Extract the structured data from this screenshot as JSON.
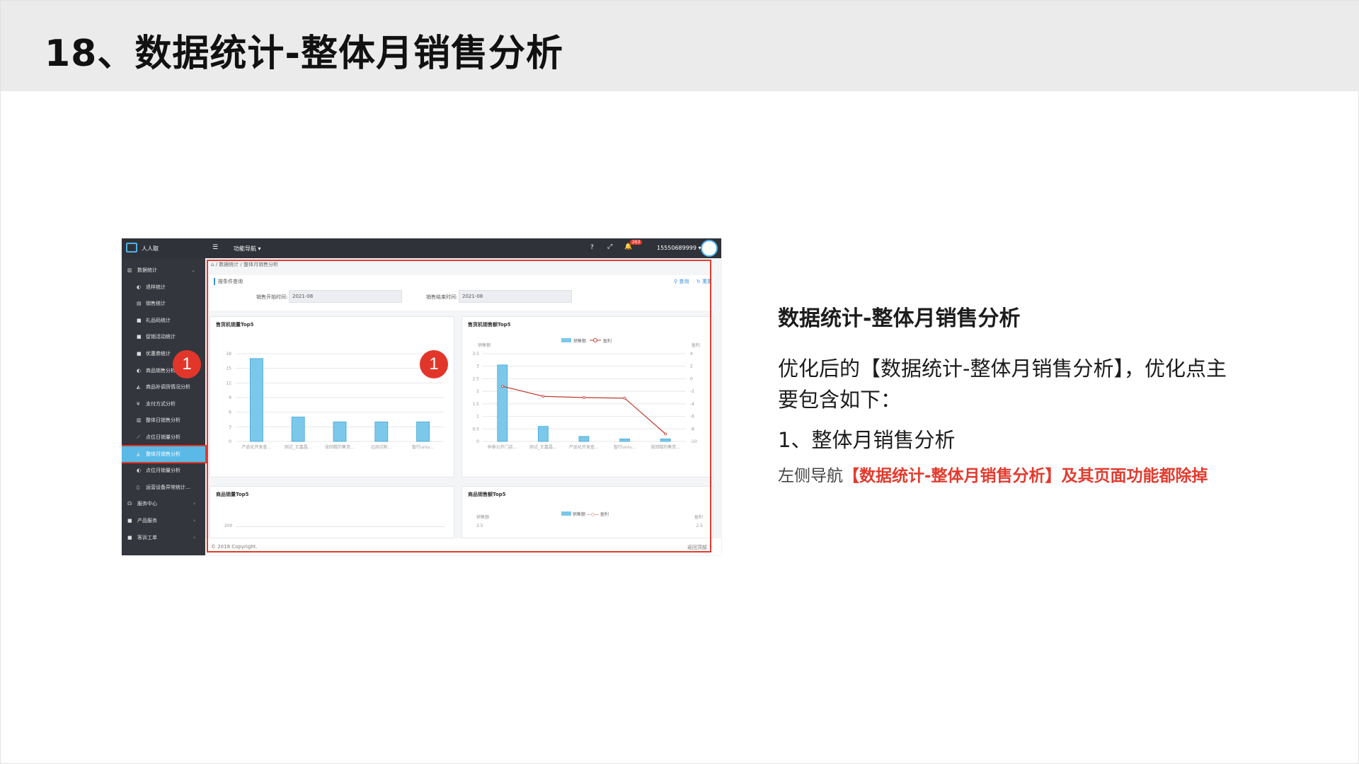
{
  "slide": {
    "title": "18、数据统计-整体月销售分析"
  },
  "screenshot": {
    "topbar": {
      "app_name": "人人取",
      "nav_label": "功能导航 ▾",
      "badge_count": "263",
      "user": "15550689999 ▾"
    },
    "sidebar": {
      "items": [
        {
          "label": "数据统计",
          "icon": "bar-chart-icon",
          "arrow": "⌄"
        },
        {
          "label": "退样统计",
          "icon": "pie-icon"
        },
        {
          "label": "销售统计",
          "icon": "doc-icon"
        },
        {
          "label": "礼品码统计",
          "icon": "square-icon"
        },
        {
          "label": "促销活动统计",
          "icon": "square-icon"
        },
        {
          "label": "优惠券统计",
          "icon": "square-icon"
        },
        {
          "label": "商品销售分析",
          "icon": "pie-icon"
        },
        {
          "label": "商品补调货情况分析",
          "icon": "area-chart-icon"
        },
        {
          "label": "支付方式分析",
          "icon": "yen-icon"
        },
        {
          "label": "整体日销售分析",
          "icon": "bar-chart-icon"
        },
        {
          "label": "点位日销量分析",
          "icon": "line-chart-icon"
        },
        {
          "label": "整体月销售分析",
          "icon": "area-chart-icon"
        },
        {
          "label": "点位月销量分析",
          "icon": "pie-icon"
        },
        {
          "label": "运营设备异常统计…",
          "icon": "file-icon"
        },
        {
          "label": "服务中心",
          "icon": "headset-icon",
          "arrow": "›"
        },
        {
          "label": "产品服务",
          "icon": "square-icon",
          "arrow": "›"
        },
        {
          "label": "客诉工单",
          "icon": "square-icon",
          "arrow": "›"
        }
      ]
    },
    "breadcrumb": {
      "home": "⌂",
      "level1": "数据统计",
      "sep": "/",
      "level2": "整体月销售分析"
    },
    "query": {
      "title": "按条件查询",
      "search_btn": "查询",
      "reset_btn": "重置",
      "start_label": "销售开始时间:",
      "start_value": "2021-08",
      "end_label": "销售结束时间:",
      "end_value": "2021-08"
    },
    "panels": {
      "p1_title": "售货机销量Top5",
      "p2_title": "售货机销售额Top5",
      "p3_title": "商品销量Top5",
      "p4_title": "商品销售额Top5",
      "p4_y_left": "销售额",
      "p4_y_right": "盈利",
      "p4_tick_left": "3.5",
      "p4_tick_right": "2.5",
      "p3_tick": "200"
    },
    "footer": {
      "copyright": "© 2018 Copyright.",
      "back_to_top": "返回顶部 ⬆"
    },
    "markers": [
      "1",
      "1"
    ]
  },
  "chart_data": [
    {
      "type": "bar",
      "title": "售货机销量Top5",
      "categories": [
        "产品化开发查…",
        "测试_王嘉晶…",
        "张回楼的售货…",
        "ZJ测试柜…",
        "智行uniu…"
      ],
      "values": [
        17,
        5,
        4,
        4,
        4
      ],
      "ylim": [
        0,
        18
      ],
      "yticks": [
        "0",
        "3",
        "6",
        "9",
        "12",
        "15",
        "18"
      ],
      "color": "#7cc8ea"
    },
    {
      "type": "bar",
      "title": "售货机销售额Top5",
      "ylabel_left": "销售额",
      "ylabel_right": "盈利",
      "categories": [
        "仲景公开门店…",
        "测试_王嘉晶…",
        "产品化开发查…",
        "智行uniu…",
        "张回楼的售货…"
      ],
      "series": [
        {
          "name": "销售额",
          "type": "bar",
          "values": [
            3.05,
            0.6,
            0.2,
            0.1,
            0.1
          ],
          "color": "#7cc8ea"
        },
        {
          "name": "盈利",
          "type": "line",
          "values": [
            -1.2,
            -2.8,
            -3,
            -3.1,
            -8.8
          ],
          "color": "#c0392b"
        }
      ],
      "ylim_left": [
        0,
        3.5
      ],
      "yticks_left": [
        "0",
        "0.5",
        "1",
        "1.5",
        "2",
        "2.5",
        "3",
        "3.5"
      ],
      "ylim_right": [
        -10,
        4
      ],
      "yticks_right": [
        "-10",
        "-8",
        "-6",
        "-4",
        "-2",
        "0",
        "2",
        "4"
      ]
    }
  ],
  "right": {
    "heading": "数据统计-整体月销售分析",
    "para": "优化后的【数据统计-整体月销售分析】，优化点主要包含如下：",
    "point": "1、整体月销售分析",
    "note_prefix": "左侧导航",
    "note_highlight": "【数据统计-整体月销售分析】及其页面功能都除掉"
  }
}
